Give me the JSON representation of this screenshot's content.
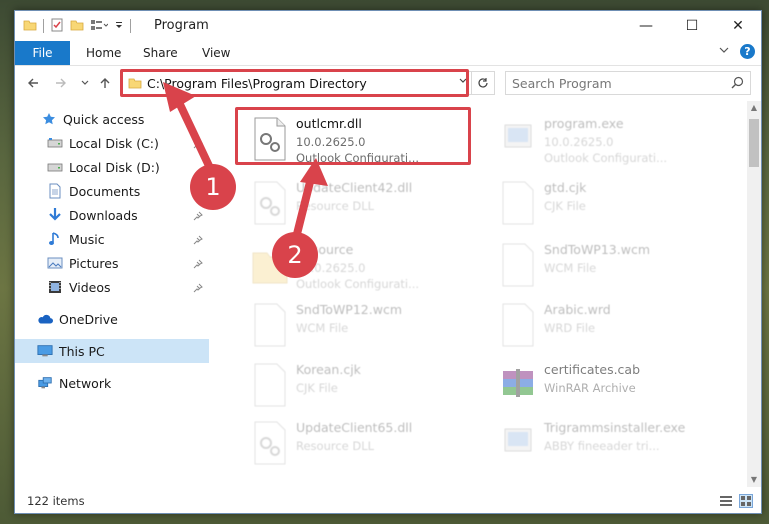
{
  "window": {
    "title": "Program",
    "controls": {
      "minimize": "—",
      "maximize": "☐",
      "close": "✕"
    }
  },
  "ribbon": {
    "tabs": [
      "File",
      "Home",
      "Share",
      "View"
    ],
    "help": "?"
  },
  "address": {
    "path": "C:\\Program Files\\Program Directory"
  },
  "search": {
    "placeholder": "Search Program"
  },
  "sidebar": {
    "items": [
      {
        "label": "Quick access",
        "icon": "star-icon"
      },
      {
        "label": "Local Disk (C:)",
        "icon": "drive-icon",
        "pinned": true
      },
      {
        "label": "Local Disk (D:)",
        "icon": "drive-icon"
      },
      {
        "label": "Documents",
        "icon": "documents-icon",
        "pinned": true
      },
      {
        "label": "Downloads",
        "icon": "downloads-icon",
        "pinned": true
      },
      {
        "label": "Music",
        "icon": "music-icon",
        "pinned": true
      },
      {
        "label": "Pictures",
        "icon": "pictures-icon",
        "pinned": true
      },
      {
        "label": "Videos",
        "icon": "videos-icon",
        "pinned": true
      },
      {
        "label": "OneDrive",
        "icon": "cloud-icon"
      },
      {
        "label": "This PC",
        "icon": "computer-icon",
        "selected": true
      },
      {
        "label": "Network",
        "icon": "network-icon"
      }
    ]
  },
  "files": [
    {
      "name": "outlcmr.dll",
      "line1": "10.0.2625.0",
      "line2": "Outlook Configurati...",
      "highlighted": true
    },
    {
      "name": "program.exe",
      "line1": "10.0.2625.0",
      "line2": "Outlook Configurati..."
    },
    {
      "name": "UpdateClient42.dll",
      "line1": "Resource DLL"
    },
    {
      "name": "gtd.cjk",
      "line1": "CJK File"
    },
    {
      "name": "Resource",
      "line1": "10.0.2625.0",
      "line2": "Outlook Configurati..."
    },
    {
      "name": "SndToWP13.wcm",
      "line1": "WCM File"
    },
    {
      "name": "SndToWP12.wcm",
      "line1": "WCM File"
    },
    {
      "name": "Arabic.wrd",
      "line1": "WRD File"
    },
    {
      "name": "Korean.cjk",
      "line1": "CJK File"
    },
    {
      "name": "certificates.cab",
      "line1": "WinRAR Archive"
    },
    {
      "name": "UpdateClient65.dll",
      "line1": "Resource DLL"
    },
    {
      "name": "Trigrammsinstaller.exe",
      "line1": "ABBY fineeader tri..."
    }
  ],
  "status": {
    "count": "122 items"
  },
  "annotations": {
    "step1": "1",
    "step2": "2"
  },
  "colors": {
    "accent": "#1979ca",
    "highlight": "#d9434b",
    "selected": "#cce4f7"
  }
}
